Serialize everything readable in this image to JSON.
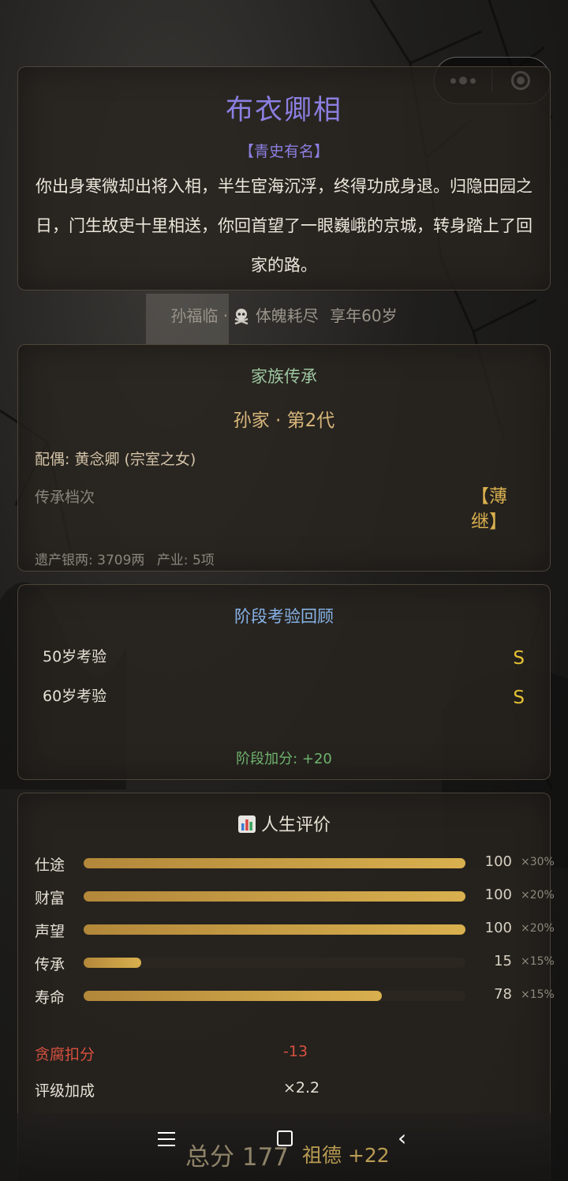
{
  "ending": {
    "title": "布衣卿相",
    "tag": "【青史有名】",
    "description": "你出身寒微却出将入相，半生宦海沉浮，终得功成身退。归隐田园之日，门生故吏十里相送，你回首望了一眼巍峨的京城，转身踏上了回家的路。"
  },
  "death": {
    "name": "孙福临",
    "separator": "·",
    "icon": "skull-crossbones-icon",
    "cause": "体魄耗尽",
    "age": "享年60岁"
  },
  "family": {
    "heading": "家族传承",
    "name": "孙家 · 第2代",
    "spouse": "配偶: 黄念卿 (宗室之女)",
    "tier_label": "传承档次",
    "tier_value": "【薄继】",
    "estate_silver": "遗产银两: 3709两",
    "estate_property": "产业: 5项"
  },
  "exams": {
    "heading": "阶段考验回顾",
    "items": [
      {
        "label": "50岁考验",
        "grade": "S"
      },
      {
        "label": "60岁考验",
        "grade": "S"
      }
    ],
    "bonus": "阶段加分: +20"
  },
  "evaluation": {
    "heading": "人生评价",
    "icon": "bar-chart-icon",
    "metrics": [
      {
        "name": "仕途",
        "value": 100,
        "weight": "×30%"
      },
      {
        "name": "财富",
        "value": 100,
        "weight": "×20%"
      },
      {
        "name": "声望",
        "value": 100,
        "weight": "×20%"
      },
      {
        "name": "传承",
        "value": 15,
        "weight": "×15%"
      },
      {
        "name": "寿命",
        "value": 78,
        "weight": "×15%"
      }
    ],
    "corruption_label": "贪腐扣分",
    "corruption_value": "-13",
    "rating_label": "评级加成",
    "rating_value": "×2.2"
  },
  "footer": {
    "total": "总分 177",
    "virtue": "祖德 +22"
  },
  "colors": {
    "ending_title": "#8b7fe0",
    "gold": "#d9b04e",
    "grade": "#e5c232",
    "green": "#6fb36d",
    "blue_heading": "#87b3e8",
    "red": "#d8503f"
  }
}
